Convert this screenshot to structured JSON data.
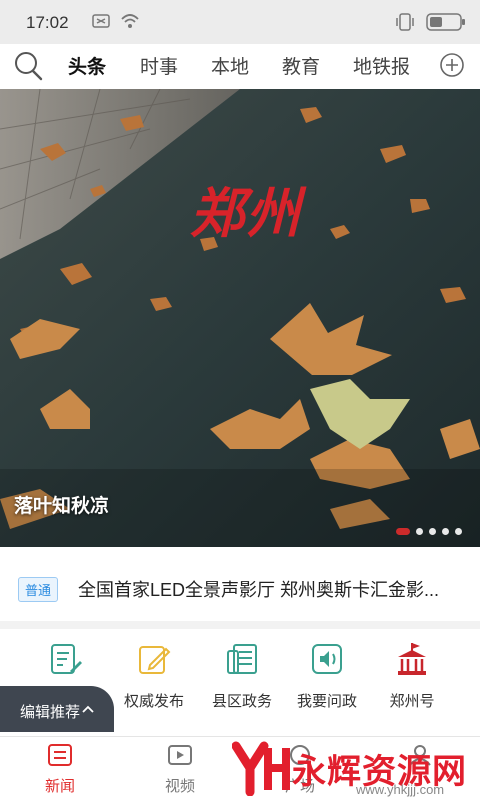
{
  "status_bar": {
    "time": "17:02"
  },
  "tabs": [
    {
      "label": "头条",
      "active": true
    },
    {
      "label": "时事",
      "active": false
    },
    {
      "label": "本地",
      "active": false
    },
    {
      "label": "教育",
      "active": false
    },
    {
      "label": "地铁报",
      "active": false
    }
  ],
  "hero": {
    "logo_text": "郑州",
    "caption": "落叶知秋凉",
    "slide_count": 5,
    "active_slide": 1
  },
  "news": {
    "badge": "普通",
    "title": "全国首家LED全景声影厅 郑州奥斯卡汇金影..."
  },
  "shortcuts": [
    {
      "label": "",
      "icon": "pen-doc-icon"
    },
    {
      "label": "权威发布",
      "icon": "edit-icon"
    },
    {
      "label": "县区政务",
      "icon": "government-doc-icon"
    },
    {
      "label": "我要问政",
      "icon": "voice-icon"
    },
    {
      "label": "郑州号",
      "icon": "building-flag-icon"
    }
  ],
  "editor_pick": {
    "label": "编辑推荐"
  },
  "bottom_nav": [
    {
      "label": "新闻",
      "active": true
    },
    {
      "label": "视频",
      "active": false
    },
    {
      "label": "广场",
      "active": false
    },
    {
      "label": "",
      "active": false
    }
  ],
  "watermark": {
    "brand": "永辉资源网",
    "url": "www.yhkjjj.com"
  },
  "colors": {
    "accent": "#e02c2c",
    "icon_green": "#3aa08f",
    "icon_yellow": "#e9b83a",
    "icon_red": "#c8262c",
    "pill_bg": "#3f4650"
  }
}
